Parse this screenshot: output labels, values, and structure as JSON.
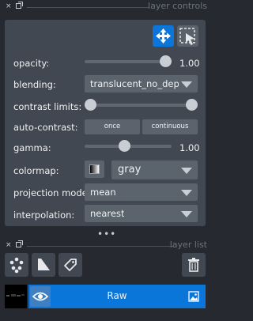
{
  "dock_controls": {
    "close": "×",
    "title": "layer controls"
  },
  "controls": {
    "opacity": {
      "label": "opacity:",
      "value": 1.0,
      "value_text": "1.00"
    },
    "blending": {
      "label": "blending:",
      "value": "translucent_no_depth"
    },
    "contrast_limits": {
      "label": "contrast limits:",
      "low": 0.0,
      "high": 1.0
    },
    "auto_contrast": {
      "label": "auto-contrast:",
      "once": "once",
      "continuous": "continuous"
    },
    "gamma": {
      "label": "gamma:",
      "value": 1.0,
      "value_text": "1.00"
    },
    "colormap": {
      "label": "colormap:",
      "value": "gray"
    },
    "projection_mode": {
      "label": "projection mode:",
      "value": "mean"
    },
    "interpolation": {
      "label": "interpolation:",
      "value": "nearest"
    }
  },
  "dots": "•••",
  "dock_layers": {
    "close": "×",
    "title": "layer list"
  },
  "layer": {
    "name": "Raw"
  },
  "colors": {
    "accent": "#0b76d9",
    "panel": "#414851",
    "background": "#262930"
  }
}
